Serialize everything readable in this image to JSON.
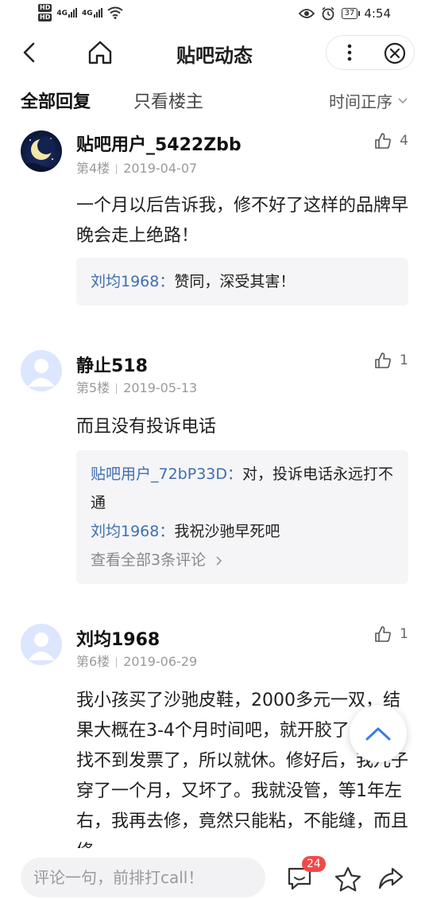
{
  "status_bar": {
    "hd1": "HD",
    "hd2": "HD",
    "net1": "4G",
    "net2": "4G",
    "battery": "37",
    "time": "4:54"
  },
  "nav": {
    "title": "贴吧动态"
  },
  "tabs": {
    "all": "全部回复",
    "owner_only": "只看楼主",
    "sort": "时间正序"
  },
  "posts": [
    {
      "user": "贴吧用户_5422Zbb",
      "floor": "第4楼",
      "date": "2019-04-07",
      "likes": "4",
      "content": "一个月以后告诉我，修不好了这样的品牌早晚会走上绝路！",
      "replies": [
        {
          "name": "刘均1968：",
          "text": "赞同，深受其害！"
        }
      ]
    },
    {
      "user": "静止518",
      "floor": "第5楼",
      "date": "2019-05-13",
      "likes": "1",
      "content": "而且没有投诉电话",
      "replies": [
        {
          "name": "贴吧用户_72bP33D：",
          "text": "对，投诉电话永远打不通"
        },
        {
          "name": "刘均1968：",
          "text": "我祝沙驰早死吧"
        }
      ],
      "more": "查看全部3条评论"
    },
    {
      "user": "刘均1968",
      "floor": "第6楼",
      "date": "2019-06-29",
      "likes": "1",
      "content": "我小孩买了沙驰皮鞋，2000多元一双，结果大概在3-4个月时间吧，就开胶了，因为找不到发票了，所以就休。修好后，我儿子穿了一个月，又坏了。我就没管，等1年左右，我再去修，竟然只能粘，不能缝，而且修"
    }
  ],
  "bottom": {
    "placeholder": "评论一句，前排打call！",
    "comment_count": "24"
  }
}
